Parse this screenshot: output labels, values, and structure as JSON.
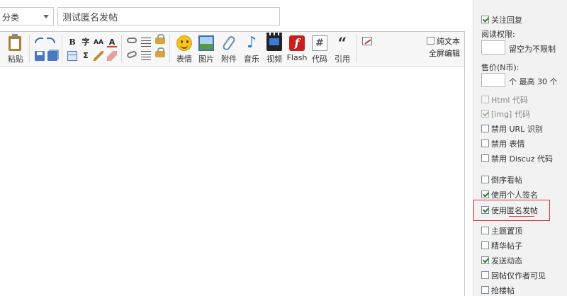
{
  "top": {
    "category_label": "分类",
    "title_value": "测试匿名发帖"
  },
  "toolbar": {
    "paste_label": "粘贴",
    "big_buttons": [
      {
        "name": "emoji",
        "label": "表情"
      },
      {
        "name": "image",
        "label": "图片"
      },
      {
        "name": "attachment",
        "label": "附件"
      },
      {
        "name": "music",
        "label": "音乐"
      },
      {
        "name": "video",
        "label": "视频"
      },
      {
        "name": "flash",
        "label": "Flash"
      },
      {
        "name": "code",
        "label": "代码"
      },
      {
        "name": "quote",
        "label": "引用"
      }
    ],
    "bold_glyph": "B",
    "font_glyph": "字",
    "fontsize_glyph": "AA",
    "color_glyph": "A",
    "sigma_glyph": "Σ",
    "code_glyph": "#",
    "quote_glyph": "“",
    "flash_glyph": "f",
    "music_glyph": "♪",
    "plain_text_label": "纯文本",
    "fullscreen_label": "全屏编辑"
  },
  "sidebar": {
    "follow_reply": {
      "label": "关注回复",
      "checked": true
    },
    "read_perm_label": "阅读权限:",
    "read_perm_hint": "留空为不限制",
    "price_label": "售价(N币):",
    "price_hint": "个 最高 30 个",
    "options": [
      {
        "key": "html",
        "label": "Html 代码",
        "checked": false,
        "disabled": true
      },
      {
        "key": "img",
        "label": "[img] 代码",
        "checked": true,
        "disabled": true
      },
      {
        "key": "no_url",
        "label": "禁用 URL 识别",
        "checked": false,
        "disabled": false
      },
      {
        "key": "no_smiley",
        "label": "禁用 表情",
        "checked": false,
        "disabled": false
      },
      {
        "key": "no_discuz",
        "label": "禁用 Discuz 代码",
        "checked": false,
        "disabled": false
      },
      {
        "key": "reverse",
        "label": "倒序看帖",
        "checked": false,
        "disabled": false
      },
      {
        "key": "signature",
        "label": "使用个人签名",
        "checked": true,
        "disabled": false
      },
      {
        "key": "anonymous",
        "label": "使用匿名发帖",
        "checked": true,
        "disabled": false
      },
      {
        "key": "sticky",
        "label": "主题置顶",
        "checked": false,
        "disabled": false
      },
      {
        "key": "digest",
        "label": "精华帖子",
        "checked": false,
        "disabled": false
      },
      {
        "key": "feed",
        "label": "发送动态",
        "checked": true,
        "disabled": false
      },
      {
        "key": "author_only",
        "label": "回帖仅作者可见",
        "checked": false,
        "disabled": false
      },
      {
        "key": "grab",
        "label": "抢楼帖",
        "checked": false,
        "disabled": false
      }
    ]
  },
  "colors": {
    "highlight": "#d9343a",
    "sidebar_bg": "#f2f2f2",
    "check": "#2d7a2d"
  }
}
